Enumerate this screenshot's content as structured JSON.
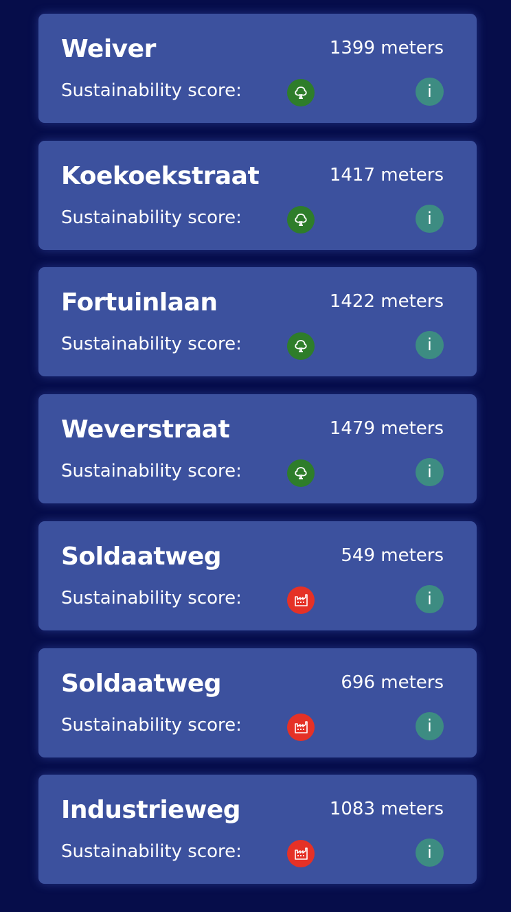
{
  "colors": {
    "background": "#060d4a",
    "card": "#3c519e",
    "score_good": "#2e7d2a",
    "score_bad": "#e53126",
    "info": "#3d8c82"
  },
  "score_label": "Sustainability score:",
  "info_glyph": "i",
  "items": [
    {
      "name": "Weiver",
      "distance": "1399 meters",
      "score_icon": "tree-icon",
      "score": "good"
    },
    {
      "name": "Koekoekstraat",
      "distance": "1417 meters",
      "score_icon": "tree-icon",
      "score": "good"
    },
    {
      "name": "Fortuinlaan",
      "distance": "1422 meters",
      "score_icon": "tree-icon",
      "score": "good"
    },
    {
      "name": "Weverstraat",
      "distance": "1479 meters",
      "score_icon": "tree-icon",
      "score": "good"
    },
    {
      "name": "Soldaatweg",
      "distance": "549 meters",
      "score_icon": "factory-icon",
      "score": "bad"
    },
    {
      "name": "Soldaatweg",
      "distance": "696 meters",
      "score_icon": "factory-icon",
      "score": "bad"
    },
    {
      "name": "Industrieweg",
      "distance": "1083 meters",
      "score_icon": "factory-icon",
      "score": "bad"
    }
  ]
}
